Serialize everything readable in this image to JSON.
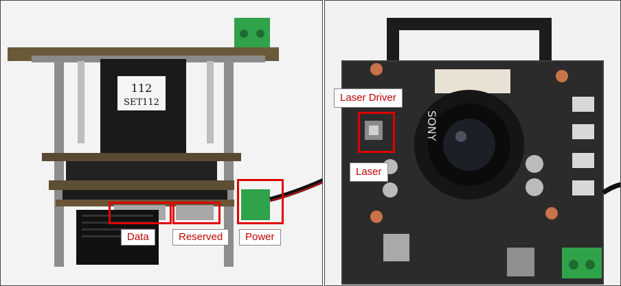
{
  "left_photo": {
    "sticker_lines": [
      "112",
      "SET112"
    ],
    "labels": {
      "data": "Data",
      "reserved": "Reserved",
      "power": "Power"
    }
  },
  "right_photo": {
    "labels": {
      "laser_driver": "Laser   Driver",
      "laser": "Laser"
    },
    "board_text": "SONY"
  }
}
